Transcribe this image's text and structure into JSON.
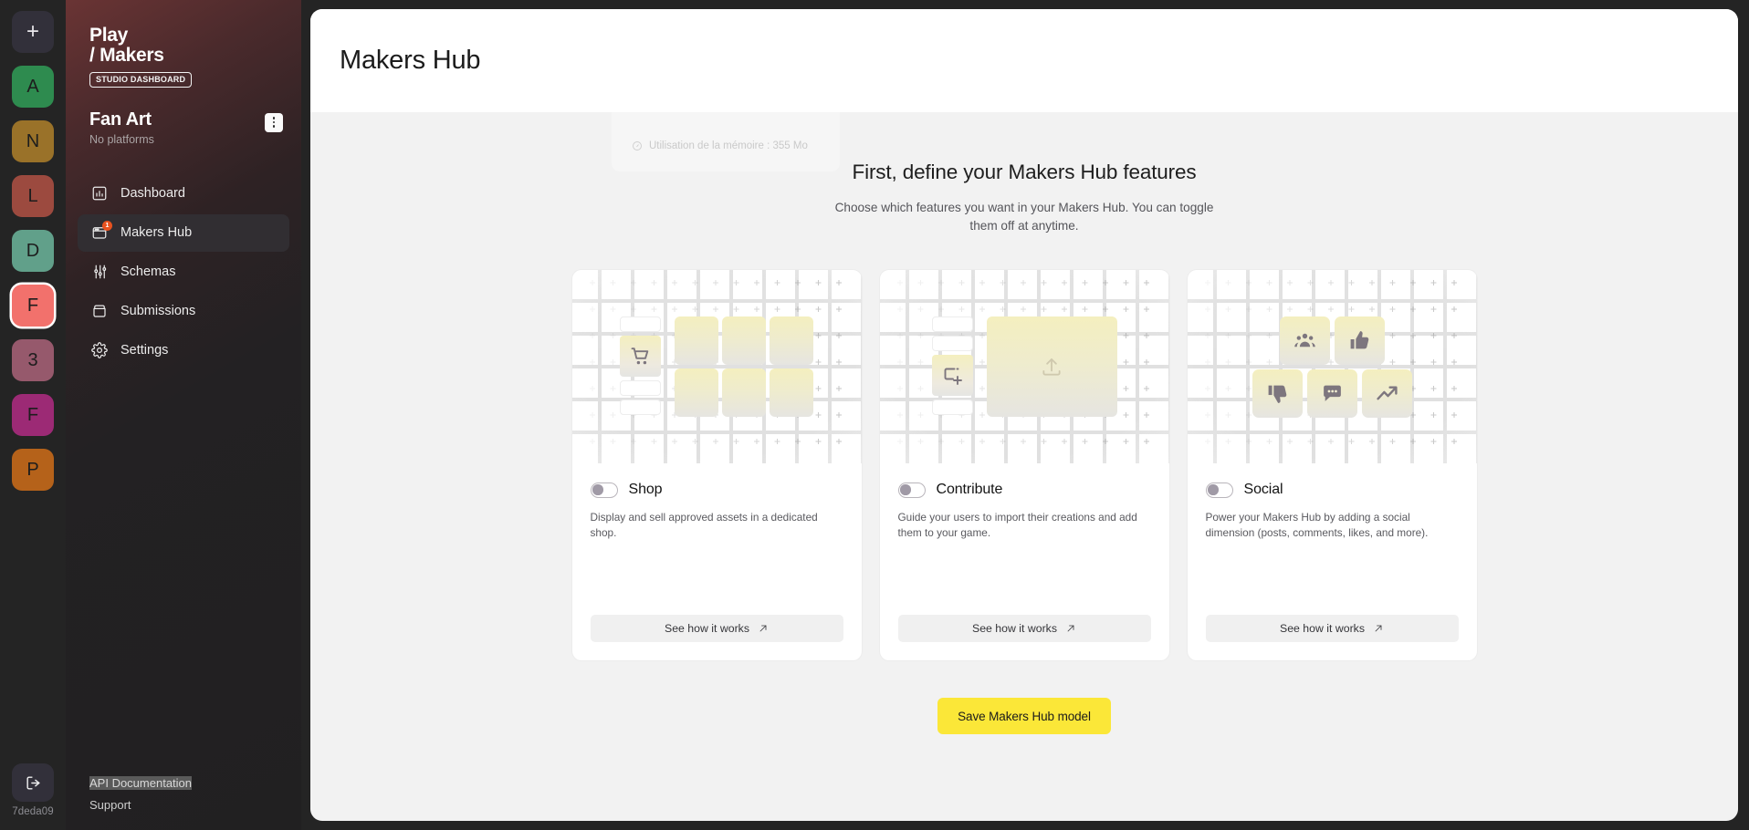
{
  "rail": {
    "add_label": "+",
    "add_icon": "plus-icon",
    "workspaces": [
      {
        "letter": "A",
        "color": "#2e8b4f"
      },
      {
        "letter": "N",
        "color": "#9a7229"
      },
      {
        "letter": "L",
        "color": "#9c4a3f"
      },
      {
        "letter": "D",
        "color": "#61a08a"
      },
      {
        "letter": "F",
        "color": "#f2716c",
        "active": true
      },
      {
        "letter": "3",
        "color": "#96596c"
      },
      {
        "letter": "F",
        "color": "#9c2a75"
      },
      {
        "letter": "P",
        "color": "#b5621a"
      }
    ],
    "logout_icon": "logout-icon",
    "user_id": "7deda09"
  },
  "sidebar": {
    "brand_line1": "Play",
    "brand_line2": "/ Makers",
    "brand_tag": "STUDIO DASHBOARD",
    "project_name": "Fan Art",
    "project_subtitle": "No platforms",
    "project_menu_icon": "kebab-menu-icon",
    "nav": [
      {
        "label": "Dashboard",
        "icon": "chart-bar-icon",
        "active": false,
        "badge": ""
      },
      {
        "label": "Makers Hub",
        "icon": "window-icon",
        "active": true,
        "badge": "1"
      },
      {
        "label": "Schemas",
        "icon": "sliders-icon",
        "active": false,
        "badge": ""
      },
      {
        "label": "Submissions",
        "icon": "archive-box-icon",
        "active": false,
        "badge": ""
      },
      {
        "label": "Settings",
        "icon": "gear-icon",
        "active": false,
        "badge": ""
      }
    ],
    "footer_links": [
      {
        "label": "API Documentation",
        "selected": true
      },
      {
        "label": "Support",
        "selected": false
      }
    ]
  },
  "header": {
    "title": "Makers Hub"
  },
  "ghost_overlay": {
    "icon": "globe-icon",
    "meter_icon": "gauge-icon",
    "memory_text": "Utilisation de la mémoire : 355 Mo"
  },
  "hero": {
    "heading": "First, define your Makers Hub features",
    "subheading": "Choose which features you want in your Makers Hub. You can toggle them off at anytime."
  },
  "cards": [
    {
      "id": "shop",
      "name": "Shop",
      "description": "Display and sell approved assets in a dedicated shop.",
      "icon": "shopping-cart-icon",
      "enabled": false,
      "cta_label": "See how it works",
      "cta_icon": "arrow-up-right-icon"
    },
    {
      "id": "contribute",
      "name": "Contribute",
      "description": "Guide your users to import their creations and add them to your game.",
      "icon": "add-frame-icon",
      "enabled": false,
      "cta_label": "See how it works",
      "cta_icon": "arrow-up-right-icon"
    },
    {
      "id": "social",
      "name": "Social",
      "description": "Power your Makers Hub by adding a social dimension (posts, comments, likes, and more).",
      "icons": [
        "people-group-icon",
        "thumbs-up-icon",
        "thumbs-down-icon",
        "comment-icon",
        "trending-up-icon"
      ],
      "enabled": false,
      "cta_label": "See how it works",
      "cta_icon": "arrow-up-right-icon"
    }
  ],
  "footer_action": {
    "save_label": "Save Makers Hub model",
    "accent_color": "#fbe738"
  }
}
